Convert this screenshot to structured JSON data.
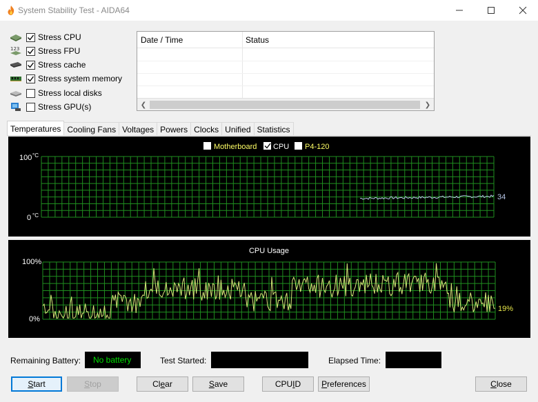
{
  "window": {
    "title": "System Stability Test - AIDA64",
    "controls": {
      "minimize": "minimize",
      "maximize": "maximize",
      "close": "close"
    }
  },
  "stress": [
    {
      "label": "Stress CPU",
      "checked": true,
      "icon": "cpu-icon"
    },
    {
      "label": "Stress FPU",
      "checked": true,
      "icon": "fpu-icon"
    },
    {
      "label": "Stress cache",
      "checked": true,
      "icon": "cache-icon"
    },
    {
      "label": "Stress system memory",
      "checked": true,
      "icon": "memory-icon"
    },
    {
      "label": "Stress local disks",
      "checked": false,
      "icon": "disk-icon"
    },
    {
      "label": "Stress GPU(s)",
      "checked": false,
      "icon": "gpu-icon"
    }
  ],
  "status_table": {
    "columns": [
      "Date / Time",
      "Status"
    ],
    "rows": []
  },
  "tabs": [
    "Temperatures",
    "Cooling Fans",
    "Voltages",
    "Powers",
    "Clocks",
    "Unified",
    "Statistics"
  ],
  "active_tab": "Temperatures",
  "temperature_graph": {
    "legend": [
      {
        "label": "Motherboard",
        "checked": false
      },
      {
        "label": "CPU",
        "checked": true
      },
      {
        "label": "P4-120",
        "checked": false
      }
    ],
    "y_top_label": "100",
    "y_bottom_label": "0",
    "unit": "°C",
    "current_value": "34",
    "colors": {
      "background": "#000000",
      "grid": "#1f8f1f",
      "line": "#b8c8e8",
      "text": "#ffffff",
      "legend_text": "#ffff66"
    }
  },
  "cpu_graph": {
    "title": "CPU Usage",
    "y_top_label": "100%",
    "y_bottom_label": "0%",
    "current_value": "19%",
    "colors": {
      "background": "#000000",
      "grid": "#1f8f1f",
      "line": "#d8e87a",
      "text": "#ffffff",
      "value_text": "#e8e84a"
    }
  },
  "footer": {
    "remaining_battery_label": "Remaining Battery:",
    "battery_value": "No battery",
    "test_started_label": "Test Started:",
    "test_started_value": "",
    "elapsed_label": "Elapsed Time:",
    "elapsed_value": ""
  },
  "buttons": {
    "start": {
      "pre": "",
      "u": "S",
      "post": "tart"
    },
    "stop": {
      "pre": "",
      "u": "S",
      "post": "top"
    },
    "clear": {
      "pre": "Cl",
      "u": "e",
      "post": "ar"
    },
    "save": {
      "pre": "",
      "u": "S",
      "post": "ave"
    },
    "cpuid": {
      "pre": "CPU",
      "u": "I",
      "post": "D"
    },
    "preferences": {
      "pre": "",
      "u": "P",
      "post": "references"
    },
    "close": {
      "pre": "",
      "u": "C",
      "post": "lose"
    }
  }
}
